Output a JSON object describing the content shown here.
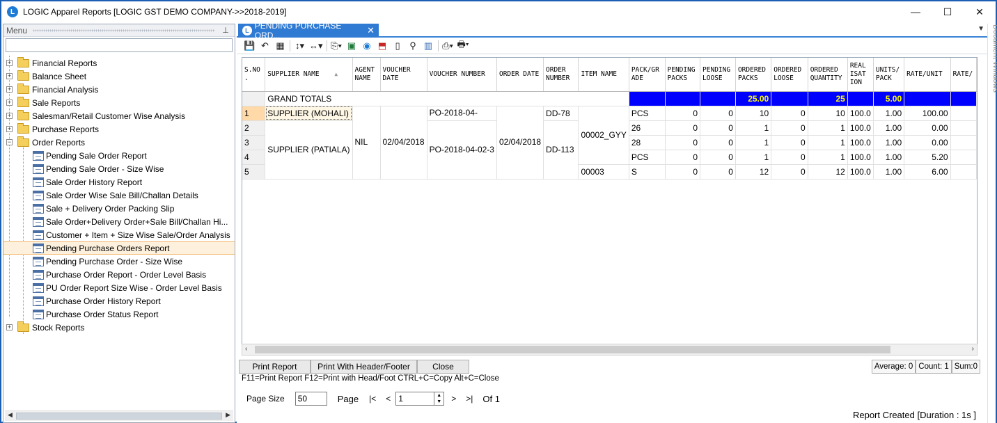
{
  "window": {
    "title": "LOGIC Apparel Reports  [LOGIC GST DEMO COMPANY->>2018-2019]",
    "app_icon_letter": "L",
    "minimize": "—",
    "maximize": "☐",
    "close": "✕"
  },
  "menu": {
    "header": "Menu",
    "pin": "📌",
    "items": [
      {
        "label": "Financial Reports",
        "expanded": false
      },
      {
        "label": "Balance Sheet",
        "expanded": false
      },
      {
        "label": "Financial Analysis",
        "expanded": false
      },
      {
        "label": "Sale Reports",
        "expanded": false
      },
      {
        "label": "Salesman/Retail Customer Wise Analysis",
        "expanded": false
      },
      {
        "label": "Purchase Reports",
        "expanded": false
      },
      {
        "label": "Order Reports",
        "expanded": true
      },
      {
        "label": "Stock Reports",
        "expanded": false
      }
    ],
    "order_children": [
      "Pending Sale Order Report",
      "Pending Sale Order - Size Wise",
      "Sale Order History Report",
      "Sale Order Wise Sale Bill/Challan Details",
      "Sale + Delivery Order Packing Slip",
      "Sale  Order+Delivery  Order+Sale  Bill/Challan  Hi...",
      "Customer + Item + Size Wise Sale/Order Analysis",
      "Pending Purchase Orders Report",
      "Pending Purchase Order - Size Wise",
      "Purchase Order Report - Order Level Basis",
      "PU Order Report Size Wise - Order Level Basis",
      "Purchase Order History Report",
      "Purchase Order Status Report"
    ],
    "selected_child": "Pending Purchase Orders Report"
  },
  "tab": {
    "title": "PENDING PURCHASE ORD...",
    "close": "✕",
    "dropdown": "▼"
  },
  "side_panel_label": "Document Windows",
  "grid": {
    "columns": [
      "S.NO .",
      "SUPPLIER NAME",
      "AGENT NAME",
      "VOUCHER DATE",
      "VOUCHER NUMBER",
      "ORDER DATE",
      "ORDER NUMBER",
      "ITEM NAME",
      "PACK/GR ADE",
      "PENDING PACKS",
      "PENDING LOOSE",
      "ORDERED PACKS",
      "ORDERED LOOSE",
      "ORDERED QUANTITY",
      "REAL ISAT ION",
      "UNITS/ PACK",
      "RATE/UNIT",
      "RATE/"
    ],
    "sort_indicator": "▲",
    "grand_total_label": "GRAND TOTALS",
    "grand_totals": {
      "ordered_packs": "25.00",
      "ordered_quantity": "25",
      "units_pack": "5.00"
    },
    "rows": [
      {
        "sno": "1",
        "supplier": "SUPPLIER (MOHALI)",
        "agent": "NIL",
        "voucher_date": "02/04/2018",
        "voucher_number": "PO-2018-04-",
        "order_date": "02/04/2018",
        "order_number": "DD-78",
        "item": "00002_GYY",
        "pack": "PCS",
        "pending_packs": "0",
        "pending_loose": "0",
        "ordered_packs": "10",
        "ordered_loose": "0",
        "ordered_qty": "10",
        "realisation": "100.0",
        "units_pack": "1.00",
        "rate_unit": "100.00"
      },
      {
        "sno": "2",
        "supplier": "SUPPLIER (PATIALA)",
        "agent": "",
        "voucher_date": "",
        "voucher_number": "PO-2018-04-02-3",
        "order_date": "",
        "order_number": "DD-113",
        "item": "",
        "pack": "26",
        "pending_packs": "0",
        "pending_loose": "0",
        "ordered_packs": "1",
        "ordered_loose": "0",
        "ordered_qty": "1",
        "realisation": "100.0",
        "units_pack": "1.00",
        "rate_unit": "0.00"
      },
      {
        "sno": "3",
        "supplier": "",
        "agent": "",
        "voucher_date": "",
        "voucher_number": "",
        "order_date": "",
        "order_number": "",
        "item": "",
        "pack": "28",
        "pending_packs": "0",
        "pending_loose": "0",
        "ordered_packs": "1",
        "ordered_loose": "0",
        "ordered_qty": "1",
        "realisation": "100.0",
        "units_pack": "1.00",
        "rate_unit": "0.00"
      },
      {
        "sno": "4",
        "supplier": "",
        "agent": "",
        "voucher_date": "",
        "voucher_number": "",
        "order_date": "",
        "order_number": "",
        "item": "",
        "pack": "PCS",
        "pending_packs": "0",
        "pending_loose": "0",
        "ordered_packs": "1",
        "ordered_loose": "0",
        "ordered_qty": "1",
        "realisation": "100.0",
        "units_pack": "1.00",
        "rate_unit": "5.20"
      },
      {
        "sno": "5",
        "supplier": "",
        "agent": "",
        "voucher_date": "",
        "voucher_number": "",
        "order_date": "",
        "order_number": "",
        "item": "00003",
        "pack": "S",
        "pending_packs": "0",
        "pending_loose": "0",
        "ordered_packs": "12",
        "ordered_loose": "0",
        "ordered_qty": "12",
        "realisation": "100.0",
        "units_pack": "1.00",
        "rate_unit": "6.00"
      }
    ]
  },
  "buttons": {
    "print": "Print Report",
    "print_header": "Print With Header/Footer",
    "close": "Close"
  },
  "hint": "F11=Print Report  F12=Print with Head/Foot  CTRL+C=Copy  Alt+C=Close",
  "status": {
    "average": "Average: 0",
    "count": "Count: 1",
    "sum": "Sum:0"
  },
  "pager": {
    "page_size_label": "Page Size",
    "page_size": "50",
    "page_label": "Page",
    "page": "1",
    "of": "Of 1",
    "first": "|<",
    "prev": "<",
    "next": ">",
    "last": ">|"
  },
  "report_created": "Report Created [Duration : 1s ]",
  "colors": {
    "accent": "#2f7ad3",
    "total_bg": "#0000ff",
    "total_fg": "#ffff00",
    "selection": "#fdf0dc"
  }
}
